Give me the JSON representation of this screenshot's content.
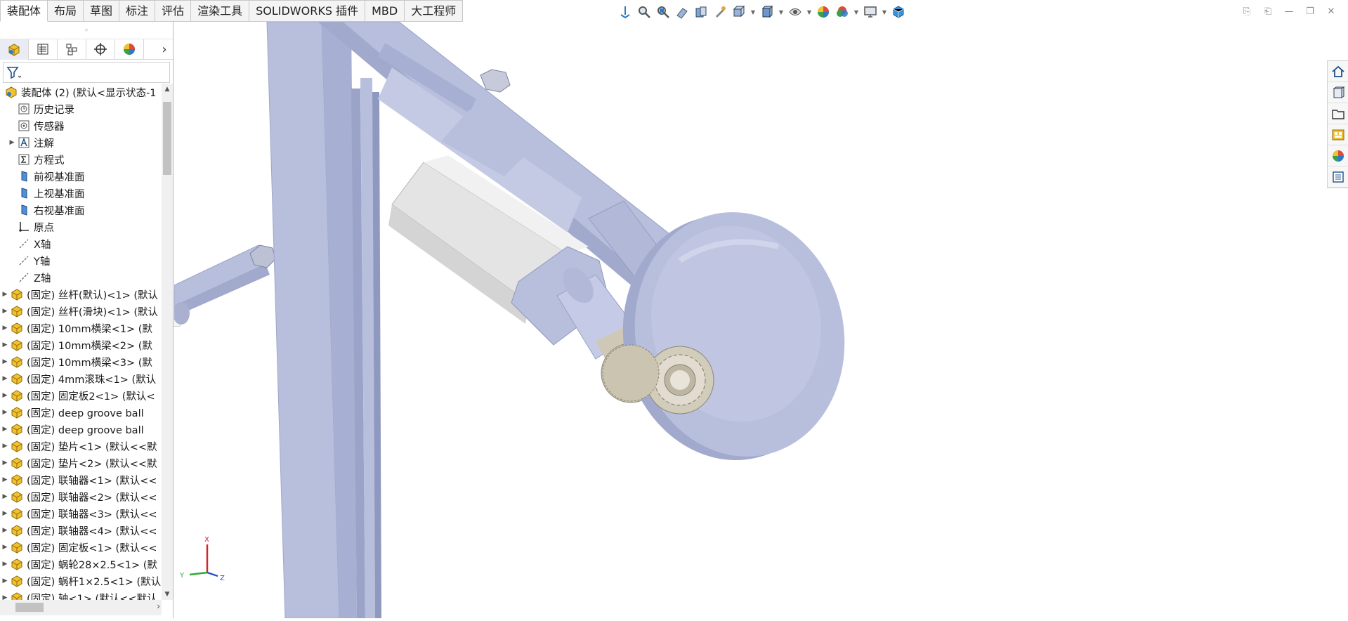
{
  "tabs": [
    "装配体",
    "布局",
    "草图",
    "标注",
    "评估",
    "渲染工具",
    "SOLIDWORKS 插件",
    "MBD",
    "大工程师"
  ],
  "active_tab": "装配体",
  "hud_icons": [
    "view-orientation-icon",
    "zoom-to-fit-icon",
    "zoom-to-area-icon",
    "previous-view-icon",
    "section-view-icon",
    "dynamic-annotation-icon",
    "view-orientation-cube-icon",
    "display-style-icon",
    "hide-show-items-icon",
    "edit-appearance-icon",
    "apply-scene-icon",
    "view-settings-icon",
    "3d-view-icon"
  ],
  "featuremanager": {
    "tabs": [
      "featuremanager-tree-icon",
      "propertymanager-icon",
      "configurationmanager-icon",
      "dimxpertmanager-icon",
      "displaymanager-icon"
    ],
    "root": "装配体 (2)  (默认<显示状态-1",
    "items": [
      {
        "label": "历史记录",
        "icon": "history-icon",
        "expand": false
      },
      {
        "label": "传感器",
        "icon": "sensor-icon",
        "expand": false
      },
      {
        "label": "注解",
        "icon": "annotation-icon",
        "expand": true
      },
      {
        "label": "方程式",
        "icon": "equation-icon",
        "expand": false
      },
      {
        "label": "前视基准面",
        "icon": "plane-icon",
        "expand": false
      },
      {
        "label": "上视基准面",
        "icon": "plane-icon",
        "expand": false
      },
      {
        "label": "右视基准面",
        "icon": "plane-icon",
        "expand": false
      },
      {
        "label": "原点",
        "icon": "origin-icon",
        "expand": false
      },
      {
        "label": "X轴",
        "icon": "axis-icon",
        "expand": false
      },
      {
        "label": "Y轴",
        "icon": "axis-icon",
        "expand": false
      },
      {
        "label": "Z轴",
        "icon": "axis-icon",
        "expand": false
      },
      {
        "label": "(固定) 丝杆(默认)<1> (默认",
        "icon": "part-icon",
        "expand": true
      },
      {
        "label": "(固定) 丝杆(滑块)<1> (默认",
        "icon": "part-icon",
        "expand": true
      },
      {
        "label": "(固定) 10mm横梁<1> (默",
        "icon": "part-icon",
        "expand": true
      },
      {
        "label": "(固定) 10mm横梁<2> (默",
        "icon": "part-icon",
        "expand": true
      },
      {
        "label": "(固定) 10mm横梁<3> (默",
        "icon": "part-icon",
        "expand": true
      },
      {
        "label": "(固定) 4mm滚珠<1> (默认",
        "icon": "part-icon",
        "expand": true
      },
      {
        "label": "(固定) 固定板2<1> (默认<",
        "icon": "part-icon",
        "expand": true
      },
      {
        "label": "(固定) deep groove ball",
        "icon": "part-icon",
        "expand": true
      },
      {
        "label": "(固定) deep groove ball",
        "icon": "part-icon",
        "expand": true
      },
      {
        "label": "(固定) 垫片<1> (默认<<默",
        "icon": "part-icon",
        "expand": true
      },
      {
        "label": "(固定) 垫片<2> (默认<<默",
        "icon": "part-icon",
        "expand": true
      },
      {
        "label": "(固定) 联轴器<1> (默认<<",
        "icon": "part-icon",
        "expand": true
      },
      {
        "label": "(固定) 联轴器<2> (默认<<",
        "icon": "part-icon",
        "expand": true
      },
      {
        "label": "(固定) 联轴器<3> (默认<<",
        "icon": "part-icon",
        "expand": true
      },
      {
        "label": "(固定) 联轴器<4> (默认<<",
        "icon": "part-icon",
        "expand": true
      },
      {
        "label": "(固定) 固定板<1> (默认<<",
        "icon": "part-icon",
        "expand": true
      },
      {
        "label": "(固定) 蜗轮28×2.5<1> (默",
        "icon": "part-icon",
        "expand": true
      },
      {
        "label": "(固定) 蜗杆1×2.5<1> (默认",
        "icon": "part-icon",
        "expand": true
      },
      {
        "label": "(固定) 轴<1> (默认<<默认",
        "icon": "part-icon",
        "expand": true
      }
    ]
  },
  "task_pane": [
    "home-icon",
    "design-library-icon",
    "file-explorer-icon",
    "view-palette-icon",
    "appearances-icon",
    "custom-properties-icon"
  ],
  "triad_labels": {
    "x": "X",
    "y": "Y",
    "z": "Z"
  },
  "colors": {
    "model": "#b8bfdd",
    "model_dark": "#9aa2c6",
    "motor": "#e4e4e4",
    "gear": "#cfc8b6",
    "accent": "#2f79c8"
  }
}
